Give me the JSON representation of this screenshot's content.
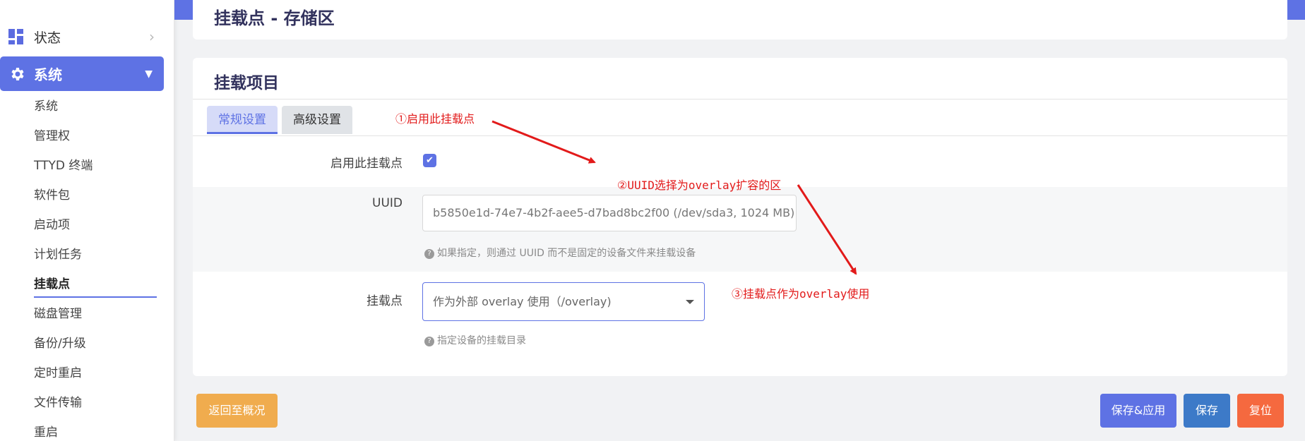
{
  "sidebar": {
    "status_label": "状态",
    "system_label": "系统",
    "items": [
      {
        "label": "系统"
      },
      {
        "label": "管理权"
      },
      {
        "label": "TTYD 终端"
      },
      {
        "label": "软件包"
      },
      {
        "label": "启动项"
      },
      {
        "label": "计划任务"
      },
      {
        "label": "挂载点"
      },
      {
        "label": "磁盘管理"
      },
      {
        "label": "备份/升级"
      },
      {
        "label": "定时重启"
      },
      {
        "label": "文件传输"
      },
      {
        "label": "重启"
      }
    ],
    "active_item": "挂载点"
  },
  "header": {
    "title": "挂载点 - 存储区"
  },
  "section": {
    "title": "挂载项目",
    "tabs": [
      {
        "label": "常规设置",
        "active": true
      },
      {
        "label": "高级设置",
        "active": false
      }
    ]
  },
  "form": {
    "enable": {
      "label": "启用此挂载点",
      "checked": true
    },
    "uuid": {
      "label": "UUID",
      "value": "b5850e1d-74e7-4b2f-aee5-d7bad8bc2f00 (/dev/sda3, 1024 MB)",
      "hint": "如果指定，则通过 UUID 而不是固定的设备文件来挂载设备"
    },
    "mountpoint": {
      "label": "挂载点",
      "value": "作为外部 overlay 使用（/overlay)",
      "hint": "指定设备的挂载目录"
    }
  },
  "annotations": [
    {
      "text": "①启用此挂载点"
    },
    {
      "text": "②UUID选择为overlay扩容的区"
    },
    {
      "text": "③挂载点作为overlay使用"
    }
  ],
  "buttons": {
    "back": "返回至概况",
    "save_apply": "保存&应用",
    "save": "保存",
    "reset": "复位"
  },
  "colors": {
    "accent": "#5e72e4",
    "annotation": "#e21a1a",
    "back_button": "#f0ac4e",
    "save_button": "#3d7ac8",
    "reset_button": "#f5693f"
  }
}
